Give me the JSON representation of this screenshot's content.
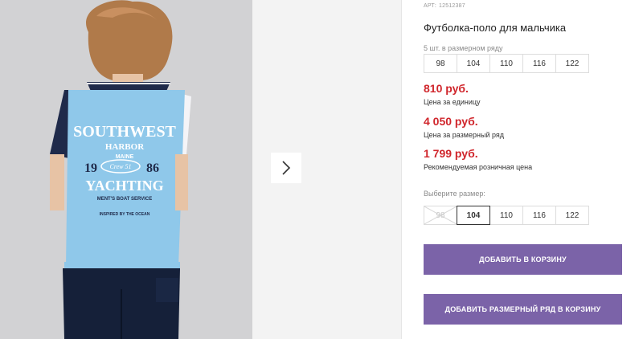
{
  "product": {
    "article_label": "АРТ:",
    "article_number": "12512387",
    "title": "Футболка-поло для мальчика",
    "size_row_note": "5 шт. в размерном ряду",
    "size_row": [
      "98",
      "104",
      "110",
      "116",
      "122"
    ],
    "prices": {
      "unit_price": "810 руб.",
      "unit_label": "Цена за единицу",
      "row_price": "4 050 руб.",
      "row_label": "Цена за размерный ряд",
      "rrp_price": "1 799 руб.",
      "rrp_label": "Рекомендуемая розничная цена"
    },
    "choose_size_label": "Выберите размер:",
    "size_options": [
      {
        "label": "98",
        "state": "disabled"
      },
      {
        "label": "104",
        "state": "selected"
      },
      {
        "label": "110",
        "state": "available"
      },
      {
        "label": "116",
        "state": "available"
      },
      {
        "label": "122",
        "state": "available"
      }
    ],
    "add_to_cart_label": "Добавить в корзину",
    "add_row_to_cart_label": "Добавить размерный ряд в корзину"
  },
  "print": {
    "line1": "SOUTHWEST",
    "line2": "HARBOR",
    "line3": "MAINE",
    "year_left": "19",
    "year_right": "86",
    "badge": "Crew 51",
    "line4": "YACHTING",
    "line5": "MENT'S BOAT SERVICE",
    "line6": "INSPIRED BY THE OCEAN"
  },
  "gallery": {
    "next_icon": "chevron-right-icon"
  },
  "colors": {
    "price": "#d0262c",
    "accent_button": "#7b63a8",
    "shirt": "#8fc8ea"
  }
}
